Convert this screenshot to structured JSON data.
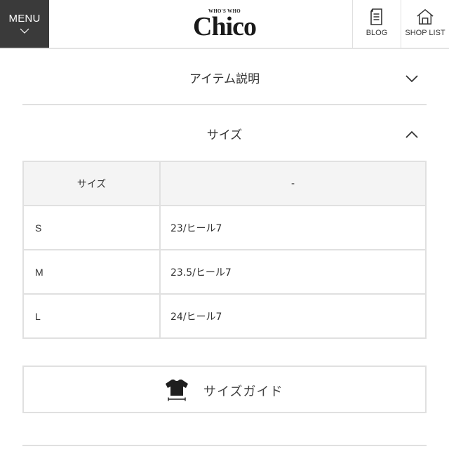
{
  "header": {
    "menu_label": "MENU",
    "logo_small": "WHO'S WHO",
    "logo_main": "Chico",
    "blog_label": "BLOG",
    "shop_list_label": "SHOP LIST"
  },
  "accordions": [
    {
      "title": "アイテム説明",
      "state": "collapsed"
    },
    {
      "title": "サイズ",
      "state": "expanded"
    }
  ],
  "size_table": {
    "headers": [
      "サイズ",
      "-"
    ],
    "rows": [
      [
        "S",
        "23/ヒール7"
      ],
      [
        "M",
        "23.5/ヒール7"
      ],
      [
        "L",
        "24/ヒール7"
      ]
    ]
  },
  "size_guide": {
    "label": "サイズガイド",
    "icon": "tshirt-icon"
  },
  "colors": {
    "menu_bg": "#3a3a3a",
    "border": "#e0e0e0",
    "header_cell_bg": "#f4f4f4"
  }
}
